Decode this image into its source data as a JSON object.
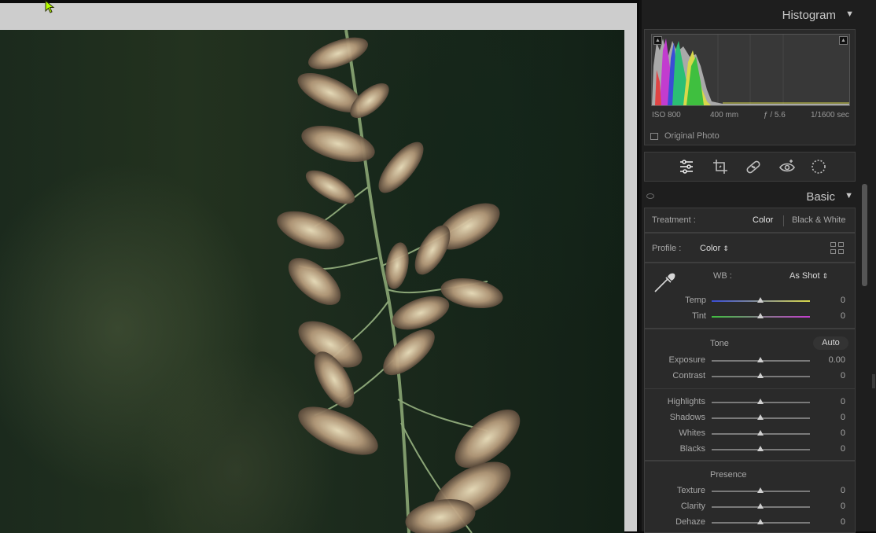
{
  "histogram": {
    "title": "Histogram",
    "iso": "ISO 800",
    "focal_length": "400 mm",
    "aperture": "ƒ / 5.6",
    "shutter": "1/1600 sec",
    "original_photo_label": "Original Photo"
  },
  "tools": [
    "edit-sliders-icon",
    "crop-icon",
    "healing-icon",
    "red-eye-icon",
    "masking-icon"
  ],
  "basic": {
    "title": "Basic",
    "treatment_label": "Treatment :",
    "treatment_color": "Color",
    "treatment_bw": "Black & White",
    "profile_label": "Profile :",
    "profile_value": "Color",
    "wb_label": "WB :",
    "wb_value": "As Shot",
    "temp": {
      "label": "Temp",
      "value": "0"
    },
    "tint": {
      "label": "Tint",
      "value": "0"
    },
    "tone_label": "Tone",
    "auto_label": "Auto",
    "exposure": {
      "label": "Exposure",
      "value": "0.00"
    },
    "contrast": {
      "label": "Contrast",
      "value": "0"
    },
    "highlights": {
      "label": "Highlights",
      "value": "0"
    },
    "shadows": {
      "label": "Shadows",
      "value": "0"
    },
    "whites": {
      "label": "Whites",
      "value": "0"
    },
    "blacks": {
      "label": "Blacks",
      "value": "0"
    },
    "presence_label": "Presence",
    "texture": {
      "label": "Texture",
      "value": "0"
    },
    "clarity": {
      "label": "Clarity",
      "value": "0"
    },
    "dehaze": {
      "label": "Dehaze",
      "value": "0"
    }
  },
  "colors": {
    "panel_bg": "#1e1e1e",
    "section_bg": "#2a2a2a",
    "cursor": "#b6ff00"
  }
}
